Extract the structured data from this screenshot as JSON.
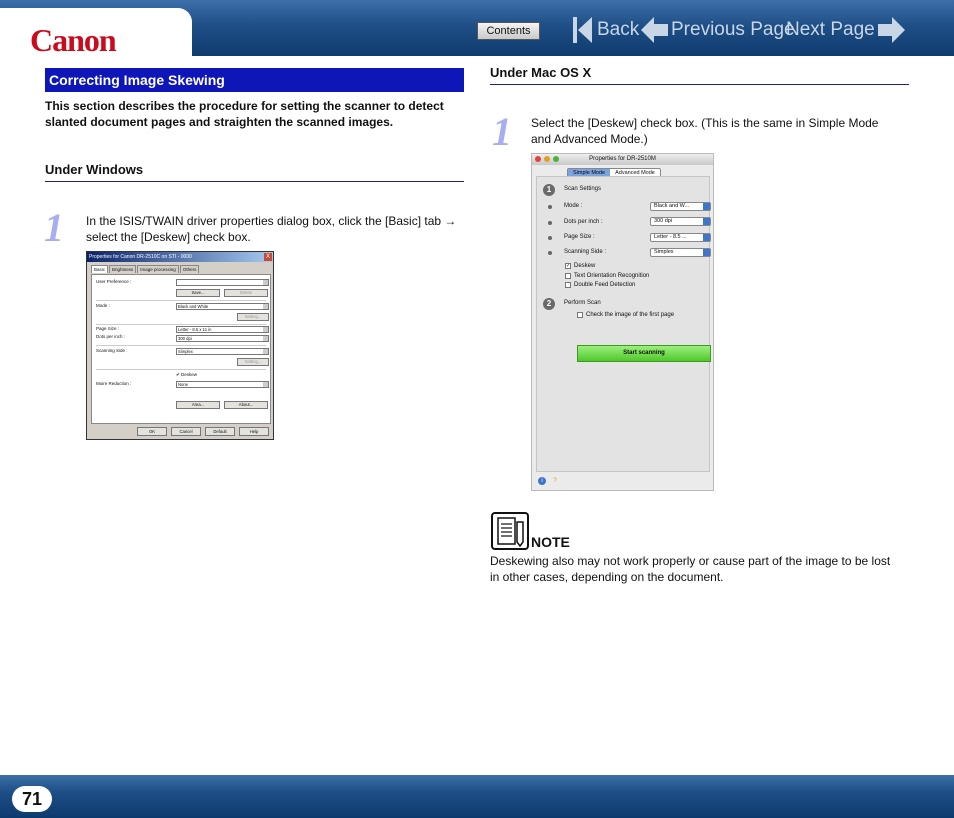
{
  "header": {
    "logo": "Canon",
    "contents_label": "Contents",
    "back_label": "Back",
    "prev_label": "Previous Page",
    "next_label": "Next Page"
  },
  "section": {
    "title": "Correcting Image Skewing",
    "intro": "This section describes the procedure for setting the scanner to detect slanted document pages and straighten the scanned images."
  },
  "windows": {
    "heading": "Under Windows",
    "step_number": "1",
    "step_text": "In the ISIS/TWAIN driver properties dialog box, click the [Basic] tab → select the [Deskew] check box.",
    "dialog": {
      "title": "Properties for Canon DR-2510C on STI - 0000",
      "close": "X",
      "tabs": [
        "Basic",
        "Brightness",
        "Image processing",
        "Others"
      ],
      "user_pref_label": "User Preference :",
      "save_btn": "Save...",
      "delete_btn": "Delete",
      "mode_label": "Mode :",
      "mode_value": "Black and White",
      "setting_btn": "Setting...",
      "page_size_label": "Page Size :",
      "page_size_value": "Letter - 8.5 x 11 in",
      "dpi_label": "Dots per inch :",
      "dpi_value": "300 dpi",
      "side_label": "Scanning Side :",
      "side_value": "Simplex",
      "deskew_label": "Deskew",
      "noise_label": "Moire Reduction :",
      "noise_value": "None",
      "area_btn": "Area...",
      "about_btn": "About...",
      "ok_btn": "OK",
      "cancel_btn": "Cancel",
      "default_btn": "Default",
      "help_btn": "Help"
    }
  },
  "mac": {
    "heading": "Under Mac OS X",
    "step_number": "1",
    "step_text": "Select the [Deskew] check box. (This is the same in Simple Mode and Advanced Mode.)",
    "dialog": {
      "title": "Properties for DR-2510M",
      "tab_simple": "Simple Mode",
      "tab_advanced": "Advanced Mode",
      "step1": "1",
      "scan_settings": "Scan Settings",
      "mode_label": "Mode :",
      "mode_value": "Black and W...",
      "dpi_label": "Dots per inch :",
      "dpi_value": "300 dpi",
      "page_size_label": "Page Size :",
      "page_size_value": "Letter - 8.5 ...",
      "side_label": "Scanning Side :",
      "side_value": "Simplex",
      "deskew": "Deskew",
      "text_orient": "Text Orientation Recognition",
      "double_feed": "Double Feed Detection",
      "step2": "2",
      "perform_scan": "Perform Scan",
      "check_first": "Check the image of the first page",
      "start_scanning": "Start scanning",
      "info_glyph": "i",
      "help_glyph": "?"
    }
  },
  "note": {
    "label": "NOTE",
    "text": "Deskewing also may not work properly or cause part of the image to be lost in other cases, depending on the document."
  },
  "footer": {
    "page_number": "71"
  },
  "colors": {
    "header_blue": "#1f4f87",
    "section_title_bg": "#0f16b8",
    "step_number": "#a9aef0",
    "logo_red": "#cc0a1d"
  }
}
